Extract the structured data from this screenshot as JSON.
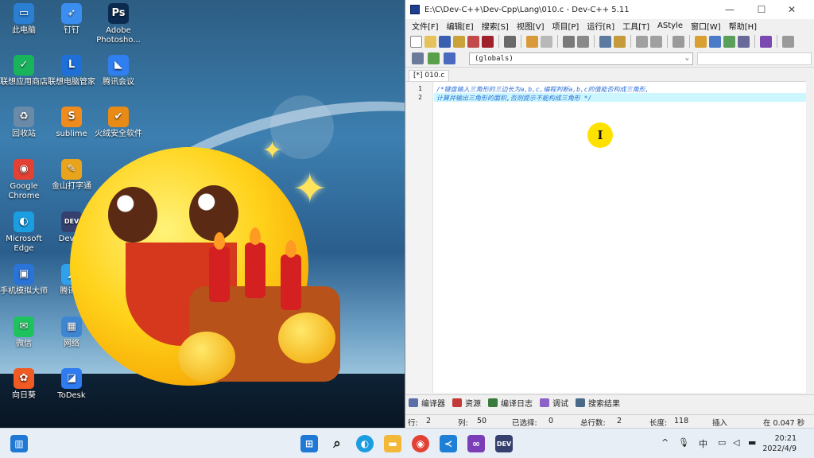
{
  "desktop": {
    "icons": [
      {
        "label": "此电脑",
        "glyph": "▭",
        "color": "#2b7fd3"
      },
      {
        "label": "钉钉",
        "glyph": "➶",
        "color": "#3a8ef0"
      },
      {
        "label": "Adobe Photosho...",
        "glyph": "Ps",
        "color": "#0b2a4f"
      },
      {
        "label": "联想应用商店",
        "glyph": "✓",
        "color": "#19b35c"
      },
      {
        "label": "联想电脑管家",
        "glyph": "L",
        "color": "#1f6fd8"
      },
      {
        "label": "腾讯会议",
        "glyph": "◣",
        "color": "#2f7ff0"
      },
      {
        "label": "回收站",
        "glyph": "♻",
        "color": "#6a8aa8"
      },
      {
        "label": "sublime",
        "glyph": "S",
        "color": "#f08b1e"
      },
      {
        "label": "火绒安全软件",
        "glyph": "✔",
        "color": "#e88a16"
      },
      {
        "label": "Google Chrome",
        "glyph": "◉",
        "color": "#e34133"
      },
      {
        "label": "金山打字通",
        "glyph": "✎",
        "color": "#e9a41b"
      },
      {
        "label": "Microsoft Edge",
        "glyph": "◐",
        "color": "#1b9de2"
      },
      {
        "label": "Dev-...",
        "glyph": "DEV",
        "color": "#36406f"
      },
      {
        "label": "手机模拟大师",
        "glyph": "▣",
        "color": "#2a73d8"
      },
      {
        "label": "腾讯...",
        "glyph": "◢",
        "color": "#2fa1ec"
      },
      {
        "label": "微信",
        "glyph": "✉",
        "color": "#1ec35e"
      },
      {
        "label": "网络",
        "glyph": "▦",
        "color": "#3e86d2"
      },
      {
        "label": "向日葵",
        "glyph": "✿",
        "color": "#f05a23"
      },
      {
        "label": "ToDesk",
        "glyph": "◪",
        "color": "#2f7cf0"
      }
    ]
  },
  "window": {
    "title": "E:\\C\\Dev-C++\\Dev-Cpp\\Lang\\010.c - Dev-C++ 5.11",
    "controls": {
      "min": "—",
      "max": "☐",
      "close": "✕"
    },
    "menu": [
      "文件[F]",
      "编辑[E]",
      "搜索[S]",
      "视图[V]",
      "项目[P]",
      "运行[R]",
      "工具[T]",
      "AStyle",
      "窗口[W]",
      "帮助[H]"
    ],
    "scope_combo": "(globals)",
    "tab_label": "[*] 010.c",
    "editor": {
      "lines": [
        {
          "num": "1",
          "text": "/*键盘输入三角形的三边长为a,b,c,编程判断a,b,c的值能否构成三角形,"
        },
        {
          "num": "2",
          "text": "计算并输出三角形的面积,否则提示不能构成三角形 */"
        }
      ],
      "text_cursor_glyph": "I",
      "code_color": "#2a6fd6",
      "current_line_color": "#cdf7ff"
    },
    "bottom_tabs": [
      {
        "label": "编译器",
        "color": "#5b6ea8"
      },
      {
        "label": "资源",
        "color": "#c23a3a"
      },
      {
        "label": "编译日志",
        "color": "#3a7a3a"
      },
      {
        "label": "调试",
        "color": "#8c62c8"
      },
      {
        "label": "搜索结果",
        "color": "#4a6a8a"
      }
    ],
    "status": {
      "row_label": "行:",
      "row_value": "2",
      "col_label": "列:",
      "col_value": "50",
      "selected_label": "已选择:",
      "selected_value": "0",
      "lines_label": "总行数:",
      "lines_value": "2",
      "length_label": "长度:",
      "length_value": "118",
      "mode": "插入",
      "parse_info": "在 0.047 秒"
    }
  },
  "taskbar": {
    "apps": [
      {
        "name": "start",
        "glyph": "⊞",
        "color": "#1f78d4"
      },
      {
        "name": "search",
        "glyph": "⌕",
        "color": "#222"
      },
      {
        "name": "edge",
        "glyph": "◐",
        "color": "#1b9de2"
      },
      {
        "name": "explorer",
        "glyph": "▬",
        "color": "#f2b838"
      },
      {
        "name": "chrome",
        "glyph": "◉",
        "color": "#e34133"
      },
      {
        "name": "vscode",
        "glyph": "≺",
        "color": "#1e7fd6"
      },
      {
        "name": "visual-studio",
        "glyph": "∞",
        "color": "#7a3fb8"
      },
      {
        "name": "devcpp",
        "glyph": "DEV",
        "color": "#36406f"
      }
    ],
    "tray": {
      "chevron": "^",
      "mic": "🎙",
      "ime": "中"
    },
    "clock": {
      "time": "20:21",
      "date": "2022/4/9"
    }
  }
}
